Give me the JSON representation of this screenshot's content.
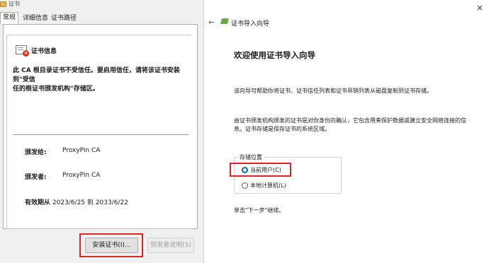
{
  "left_dialog": {
    "title": "证书",
    "tabs": [
      "常规",
      "详细信息",
      "证书路径"
    ],
    "cert_info_title": "证书信息",
    "warning_line1": "此 CA 根目录证书不受信任。要启用信任，请将该证书安装到\"受信",
    "warning_line2": "任的根证书颁发机构\"存储区。",
    "issued_to_label": "颁发给:",
    "issued_to_value": "ProxyPin CA",
    "issued_by_label": "颁发者:",
    "issued_by_value": "ProxyPin CA",
    "validity_label": "有效期从",
    "validity_from": "2023/6/25",
    "validity_to_word": "到",
    "validity_to": "2033/6/22",
    "install_button": "安装证书(I)...",
    "issuer_statement_button": "颁发者说明(S)"
  },
  "wizard": {
    "close_glyph": "×",
    "back_glyph": "←",
    "window_title": "证书导入向导",
    "heading": "欢迎使用证书导入向导",
    "para1": "该向导可帮助你将证书、证书信任列表和证书吊销列表从磁盘复制到证书存储。",
    "para2_line1": "由证书颁发机构颁发的证书是对你身份的确认，它包含用来保护数据或建立安全网络连接的信",
    "para2_line2": "息。证书存储是保存证书的系统区域。",
    "store_location_label": "存储位置",
    "options": [
      {
        "label": "当前用户(C)",
        "selected": true
      },
      {
        "label": "本地计算机(L)",
        "selected": false
      }
    ],
    "continue_text": "单击\"下一步\"继续。"
  },
  "colors": {
    "highlight_red": "#e0202a",
    "radio_blue": "#0067c0"
  }
}
